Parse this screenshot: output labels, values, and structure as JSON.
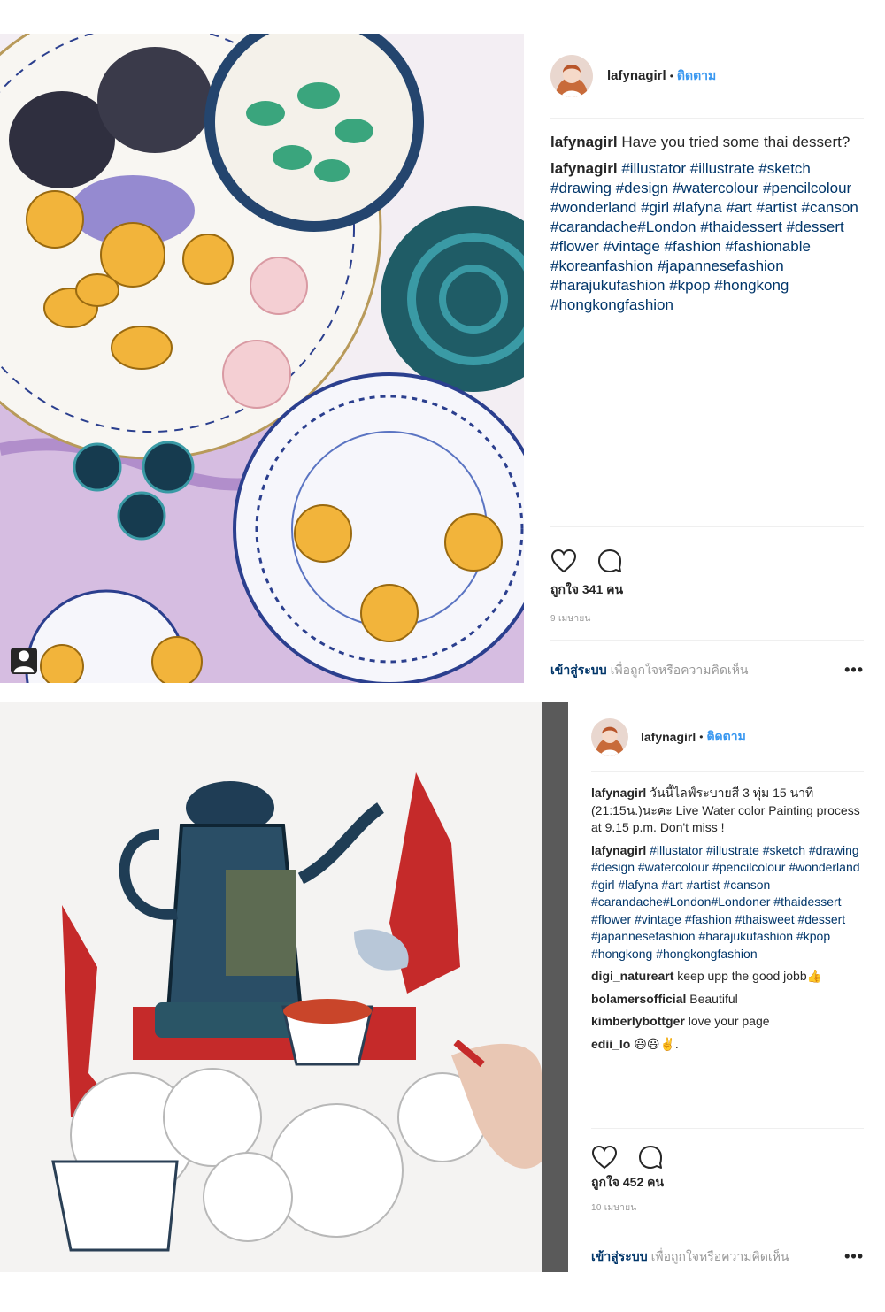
{
  "post1": {
    "username": "lafynagirl",
    "follow_label": "ติดตาม",
    "caption": "Have you tried some thai dessert?",
    "hashtags": "#illustator #illustrate #sketch #drawing #design #watercolour #pencilcolour #wonderland #girl #lafyna #art #artist #canson #carandache#London #thaidessert #dessert #flower #vintage #fashion #fashionable #koreanfashion #japannesefashion #harajukufashion #kpop #hongkong #hongkongfashion",
    "likes": "ถูกใจ 341 คน",
    "date": "9 เมษายน",
    "login_link": "เข้าสู่ระบบ",
    "login_text": "เพื่อถูกใจหรือความคิดเห็น",
    "more_label": "•••"
  },
  "post2": {
    "username": "lafynagirl",
    "follow_label": "ติดตาม",
    "caption": "วันนี้ไลฟ์ระบายสี 3 ทุ่ม 15 นาที (21:15น.)นะคะ Live Water color Painting process at 9.15 p.m. Don't miss !",
    "hashtags": "#illustator #illustrate #sketch #drawing #design #watercolour #pencilcolour #wonderland #girl #lafyna #art #artist #canson #carandache#London#Londoner #thaidessert #flower #vintage #fashion #thaisweet #dessert #japannesefashion #harajukufashion #kpop #hongkong #hongkongfashion",
    "comments": [
      {
        "user": "digi_natureart",
        "text": "keep upp the good jobb👍"
      },
      {
        "user": "bolamersofficial",
        "text": "Beautiful"
      },
      {
        "user": "kimberlybottger",
        "text": "love your page"
      },
      {
        "user": "edii_lo",
        "text": "😃😃✌️."
      }
    ],
    "likes": "ถูกใจ 452 คน",
    "date": "10 เมษายน",
    "login_link": "เข้าสู่ระบบ",
    "login_text": "เพื่อถูกใจหรือความคิดเห็น",
    "more_label": "•••"
  },
  "icons": {
    "heart": "heart-icon",
    "comment": "comment-icon",
    "profile": "user-tag-icon"
  },
  "colors": {
    "link_blue": "#3897f0",
    "hashtag": "#003569",
    "muted": "#999999",
    "text": "#262626"
  }
}
